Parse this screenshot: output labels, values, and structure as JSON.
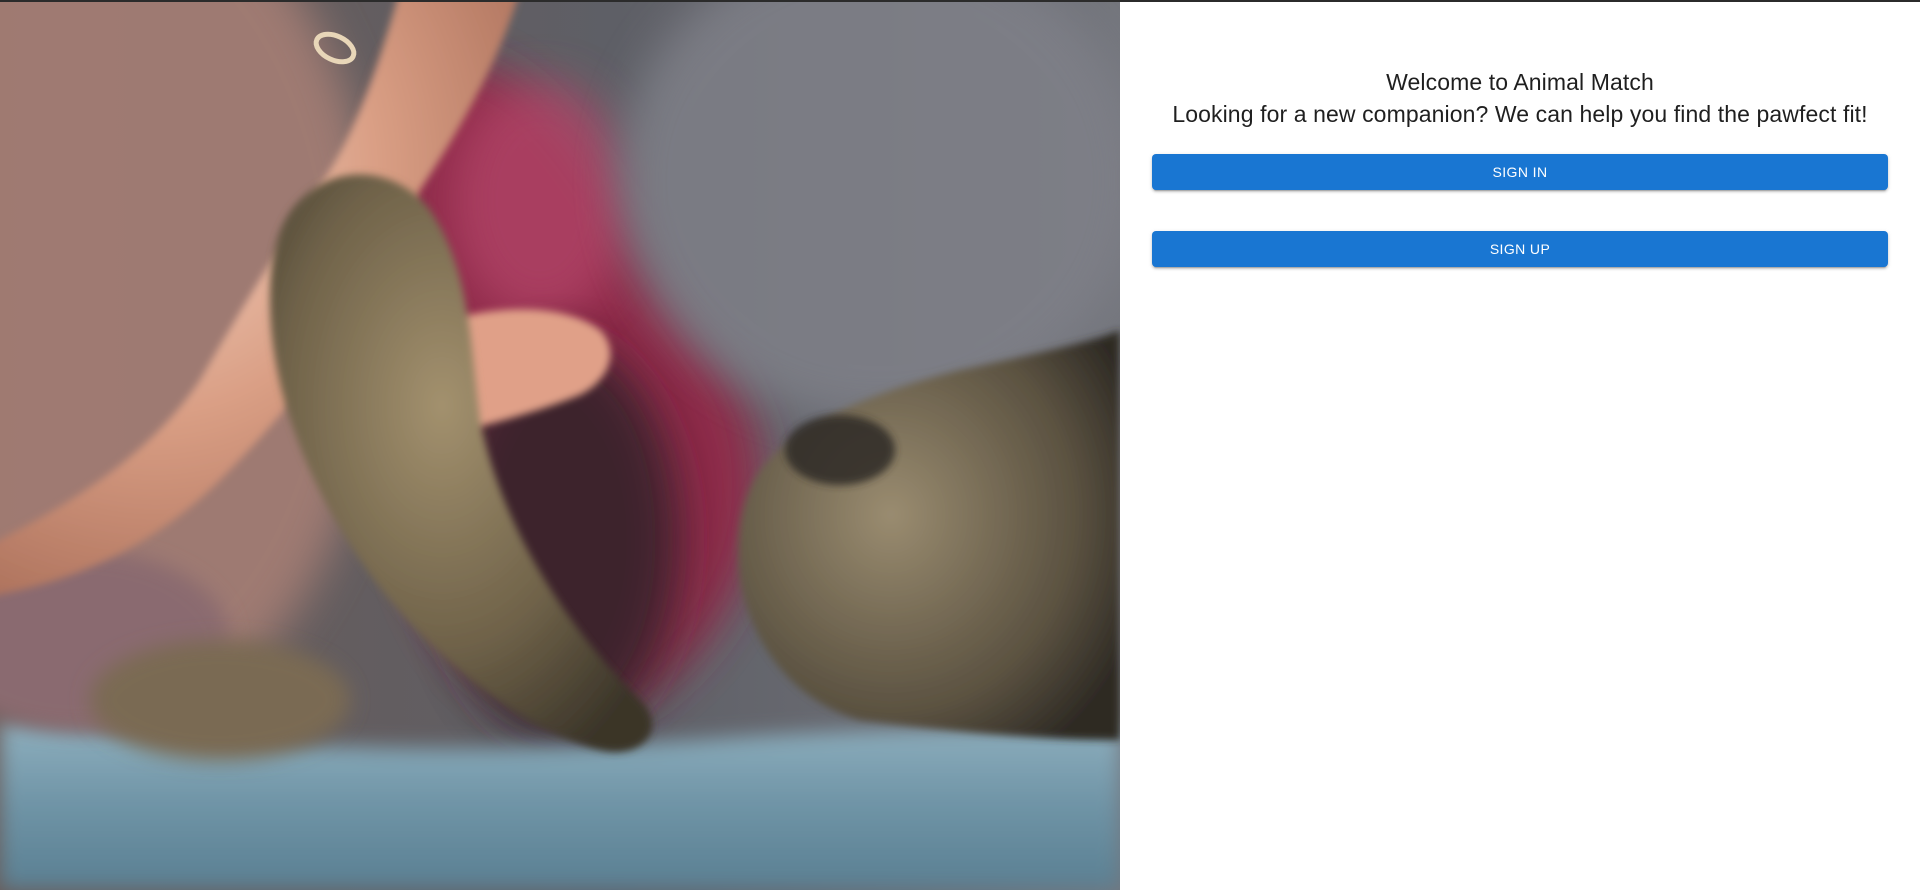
{
  "hero": {
    "image": "kitten-paw-high-five-photo"
  },
  "welcome": {
    "title": "Welcome to Animal Match",
    "subtitle": "Looking for a new companion? We can help you find the pawfect fit!"
  },
  "actions": {
    "sign_in_label": "SIGN IN",
    "sign_up_label": "SIGN UP"
  },
  "colors": {
    "primary": "#1976d2",
    "text": "#1f1f1f",
    "background": "#ffffff"
  }
}
